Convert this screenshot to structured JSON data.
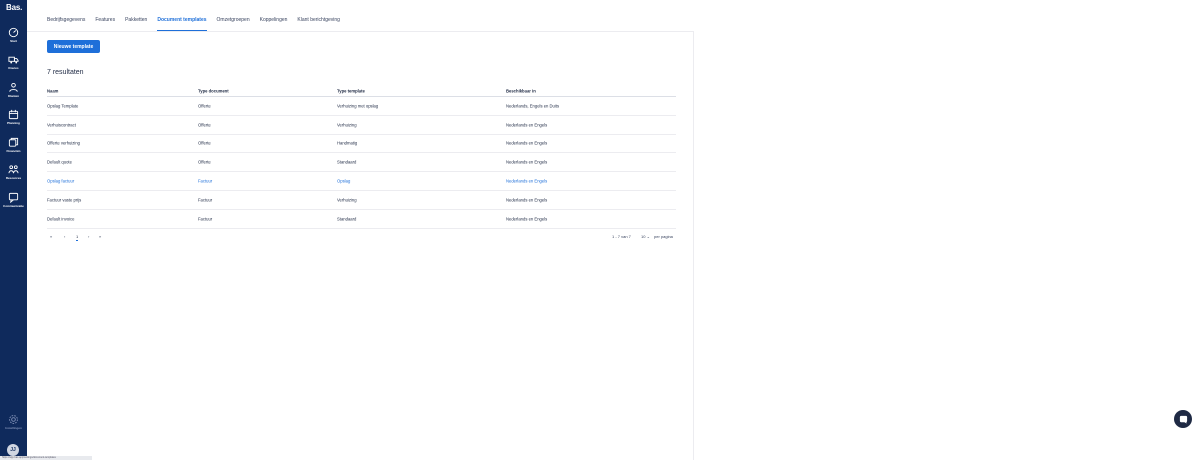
{
  "brand": {
    "logo": "Bas."
  },
  "sidebar": {
    "items": [
      {
        "label": "Start",
        "icon": "dashboard-icon"
      },
      {
        "label": "Routes",
        "icon": "truck-icon"
      },
      {
        "label": "Klanten",
        "icon": "users-icon"
      },
      {
        "label": "Planning",
        "icon": "calendar-icon"
      },
      {
        "label": "Financiën",
        "icon": "finance-icon"
      },
      {
        "label": "Resources",
        "icon": "resources-icon"
      },
      {
        "label": "Communicatie",
        "icon": "chat-icon"
      }
    ],
    "settings_label": "Instellingen",
    "avatar_initials": "JJ"
  },
  "status_tooltip": "https://app.bas.app/settings/document-templates",
  "tabs": [
    {
      "label": "Bedrijfsgegevens",
      "active": false
    },
    {
      "label": "Features",
      "active": false
    },
    {
      "label": "Pakketten",
      "active": false
    },
    {
      "label": "Document templates",
      "active": true
    },
    {
      "label": "Omzetgroepen",
      "active": false
    },
    {
      "label": "Koppelingen",
      "active": false
    },
    {
      "label": "Klant berichtgeving",
      "active": false
    }
  ],
  "new_template_button": "Nieuwe template",
  "results_label": "7 resultaten",
  "table": {
    "headers": [
      "Naam",
      "Type document",
      "Type template",
      "Beschikbaar in"
    ],
    "rows": [
      [
        "Opslag Template",
        "Offerte",
        "Verhuizing met opslag",
        "Nederlands, Engels en Duits"
      ],
      [
        "Verhuiscontract",
        "Offerte",
        "Verhuizing",
        "Nederlands en Engels"
      ],
      [
        "Offerte verhuizing",
        "Offerte",
        "Handmatig",
        "Nederlands en Engels"
      ],
      [
        "Default quote",
        "Offerte",
        "Standaard",
        "Nederlands en Engels"
      ],
      [
        "Opslag factuur",
        "Factuur",
        "Opslag",
        "Nederlands en Engels"
      ],
      [
        "Factuur vaste prijs",
        "Factuur",
        "Verhuizing",
        "Nederlands en Engels"
      ],
      [
        "Default invoice",
        "Factuur",
        "Standaard",
        "Nederlands en Engels"
      ]
    ],
    "highlighted_row": 4
  },
  "pagination": {
    "first": "«",
    "prev": "‹",
    "current_page": "1",
    "next": "›",
    "last": "»",
    "range": "1 - 7 van 7",
    "per_page_value": "10",
    "per_page_label": "per pagina"
  },
  "colors": {
    "sidebar": "#0f2a5c",
    "accent": "#1e6fd9",
    "text": "#1f2a44"
  }
}
